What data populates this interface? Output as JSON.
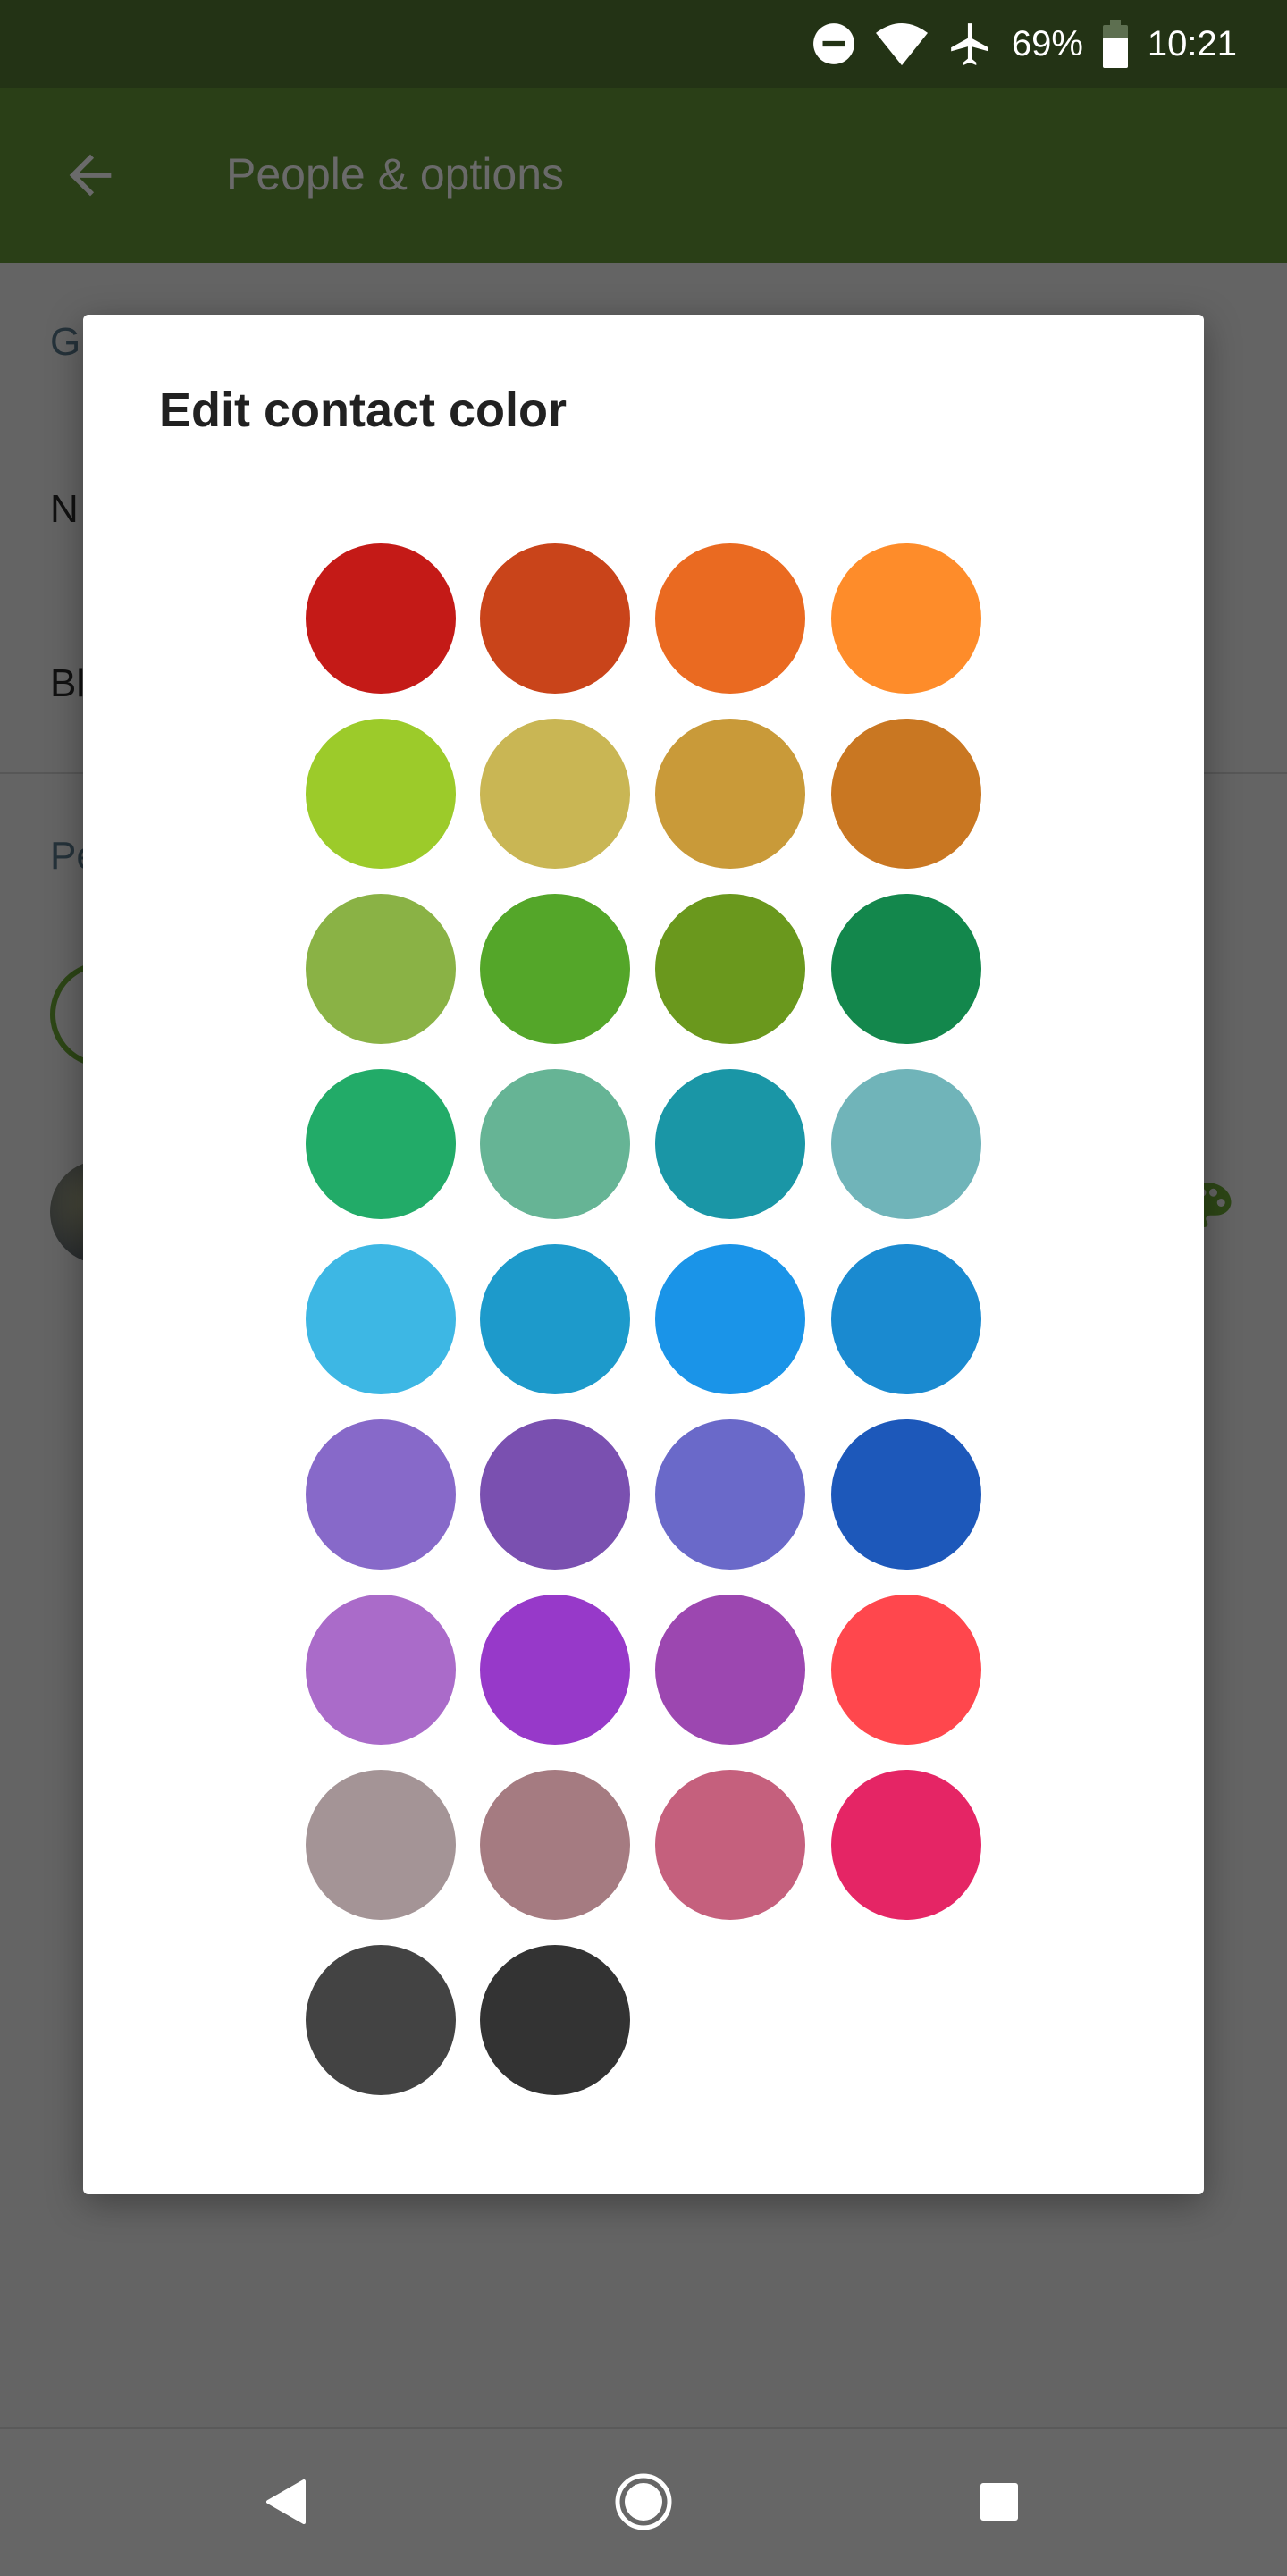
{
  "status_bar": {
    "battery": "69%",
    "time": "10:21",
    "icons": [
      "do-not-disturb-icon",
      "wifi-icon",
      "airplane-icon",
      "battery-icon"
    ]
  },
  "app_bar": {
    "title": "People & options",
    "back_icon": "arrow-left-icon"
  },
  "background": {
    "section1_header": "G",
    "item1": "N",
    "item2": "Bl",
    "section2_header": "Pe"
  },
  "dialog": {
    "title": "Edit contact color",
    "colors": [
      "#c41a17",
      "#c9441a",
      "#ea6a21",
      "#fe8c2a",
      "#9ccb2a",
      "#c9b654",
      "#c99a39",
      "#c97722",
      "#8ab245",
      "#54a629",
      "#6a981d",
      "#13874c",
      "#22ab68",
      "#66b495",
      "#1a96a6",
      "#70b4b9",
      "#3db7e4",
      "#1d9acb",
      "#1a94e8",
      "#1a8ad0",
      "#8769c9",
      "#7a50b0",
      "#6a69c9",
      "#1d58ba",
      "#aa6bc9",
      "#9739c9",
      "#9c47b0",
      "#ff474d",
      "#a49496",
      "#a57b81",
      "#c5607d",
      "#e52565",
      "#434343",
      "#333333"
    ]
  },
  "nav_bar": {
    "icons": [
      "back-triangle-icon",
      "home-circle-icon",
      "recents-square-icon"
    ]
  }
}
